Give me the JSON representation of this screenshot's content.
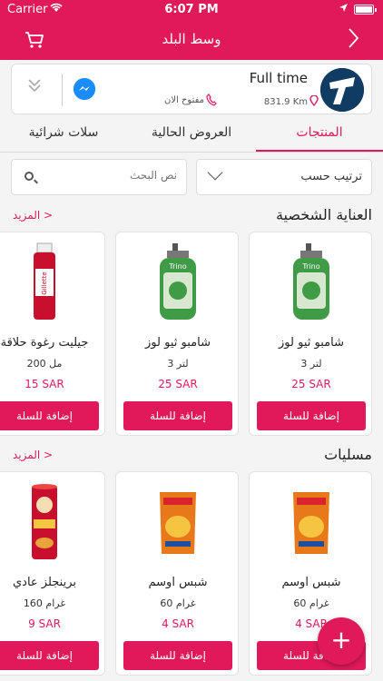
{
  "status_bar": {
    "carrier": "Carrier",
    "time": "6:07 PM"
  },
  "header": {
    "title": "وسط البلد"
  },
  "store": {
    "name": "Full time",
    "distance": "831.9 Km",
    "open_status": "مفتوح الان"
  },
  "tabs": [
    {
      "label": "المنتجات",
      "active": true
    },
    {
      "label": "العروض الحالية",
      "active": false
    },
    {
      "label": "سلات شرائية",
      "active": false
    }
  ],
  "sort": {
    "label": "ترتيب حسب"
  },
  "search": {
    "placeholder": "نص البحث"
  },
  "sections": [
    {
      "title": "العناية الشخصية",
      "more_label": "المزيد >",
      "products": [
        {
          "name": "شامبو ثيو لوز",
          "size": "3 لتر",
          "price": "25 SAR",
          "add_label": "إضافة للسلة",
          "image": "green-shampoo-bottle"
        },
        {
          "name": "شامبو ثيو لوز",
          "size": "3 لتر",
          "price": "25 SAR",
          "add_label": "إضافة للسلة",
          "image": "green-shampoo-bottle"
        },
        {
          "name": "جيليت رغوة حلاقة",
          "size": "200 مل",
          "price": "15 SAR",
          "add_label": "إضافة للسلة",
          "image": "gillette-foam-can"
        }
      ]
    },
    {
      "title": "مسليات",
      "more_label": "المزيد >",
      "products": [
        {
          "name": "شبس اوسم",
          "size": "60 غرام",
          "price": "4 SAR",
          "add_label": "إضافة للسلة",
          "image": "bamba-snack-bag"
        },
        {
          "name": "شبس اوسم",
          "size": "60 غرام",
          "price": "4 SAR",
          "add_label": "إضافة للسلة",
          "image": "bamba-snack-bag"
        },
        {
          "name": "برينجلز عادي",
          "size": "160 غرام",
          "price": "9 SAR",
          "add_label": "إضافة للسلة",
          "image": "pringles-can"
        }
      ]
    }
  ],
  "colors": {
    "brand": "#e0195a",
    "background": "#f4f4f4"
  },
  "fab": {
    "icon": "plus-icon"
  }
}
